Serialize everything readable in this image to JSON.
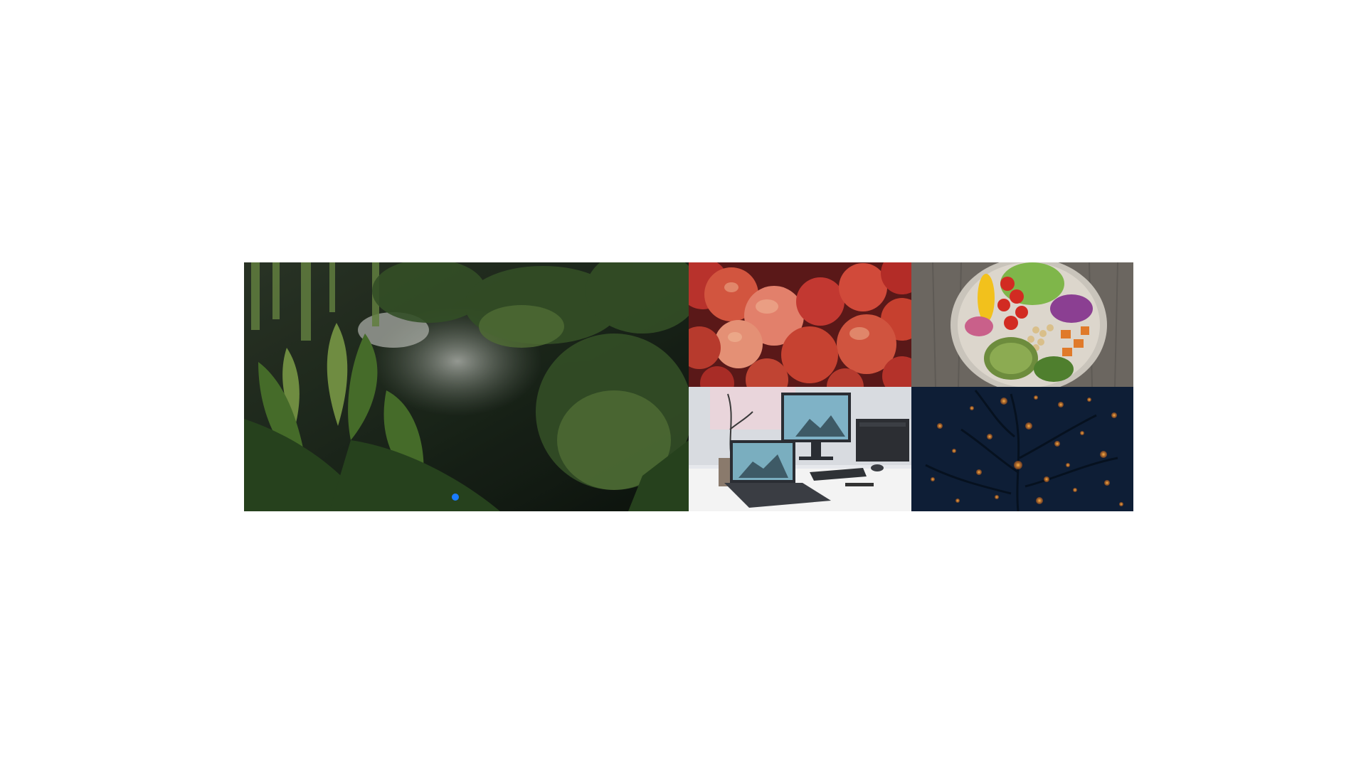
{
  "gallery": {
    "tiles": [
      {
        "subject": "tropical-plants-greenhouse",
        "icon": "plants-photo"
      },
      {
        "subject": "red-apples",
        "icon": "apples-photo"
      },
      {
        "subject": "vegetable-salad-bowl",
        "icon": "salad-bowl-photo"
      },
      {
        "subject": "desk-setup-laptop-monitor",
        "icon": "workspace-photo"
      },
      {
        "subject": "bokeh-lights-tree-night",
        "icon": "bokeh-lights-photo"
      }
    ],
    "active_slide": 1,
    "colors": {
      "accent_dot": "#1a7cff",
      "background": "#ffffff"
    }
  }
}
